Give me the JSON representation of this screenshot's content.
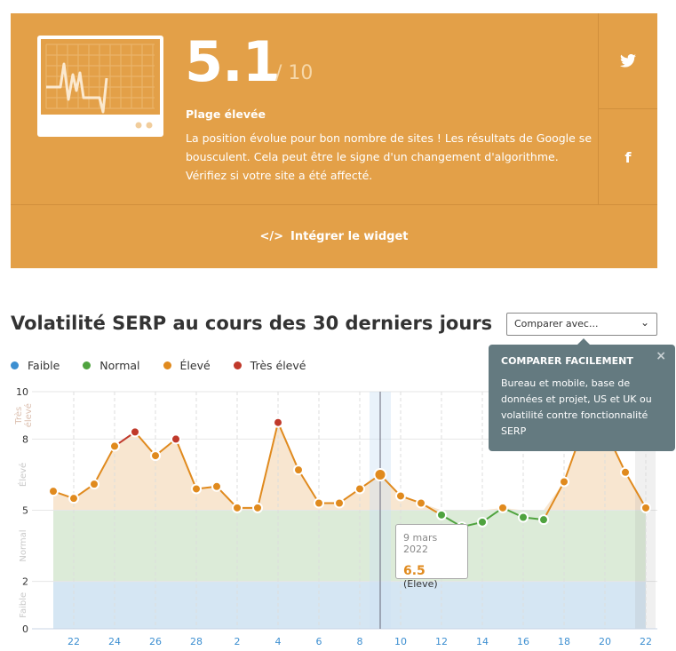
{
  "widget": {
    "score": "5.1",
    "out_of": "/ 10",
    "range_label": "Plage élevée",
    "description": "La position évolue pour bon nombre de sites ! Les résultats de Google se bousculent. Cela peut être le signe d'un changement d'algorithme. Vérifiez si votre site a été affecté.",
    "embed_label": "Intégrer le widget",
    "share": [
      "twitter-icon",
      "facebook-icon"
    ],
    "color": "#E3A048"
  },
  "section": {
    "title": "Volatilité SERP au cours des 30 derniers jours",
    "compare_select": "Comparer avec..."
  },
  "legend": [
    {
      "label": "Faible",
      "color": "#3d8fd1"
    },
    {
      "label": "Normal",
      "color": "#4fa33f"
    },
    {
      "label": "Élevé",
      "color": "#E08A1E"
    },
    {
      "label": "Très élevé",
      "color": "#c0392b"
    }
  ],
  "tooltip": {
    "date": "9 mars 2022",
    "value": "6.5",
    "category": "(Eleve)"
  },
  "popover": {
    "title": "COMPARER FACILEMENT",
    "body": "Bureau et mobile, base de données et projet, US et UK ou volatilité contre fonctionnalité SERP",
    "close": "×"
  },
  "chart_data": {
    "type": "line",
    "x": [
      "21",
      "22",
      "23",
      "24",
      "25",
      "26",
      "27",
      "28",
      "1",
      "2",
      "3",
      "4",
      "5",
      "6",
      "7",
      "8",
      "9",
      "10",
      "11",
      "12",
      "13",
      "14",
      "15",
      "16",
      "17",
      "18",
      "19",
      "20",
      "21",
      "22"
    ],
    "values": [
      5.8,
      5.5,
      6.1,
      7.7,
      8.3,
      7.3,
      8.0,
      5.9,
      6.0,
      5.1,
      5.1,
      8.7,
      6.7,
      5.3,
      5.3,
      5.9,
      6.5,
      5.6,
      5.3,
      4.8,
      4.3,
      4.5,
      5.1,
      4.7,
      4.6,
      6.2,
      8.6,
      8.4,
      6.6,
      5.1
    ],
    "xticks": [
      "22",
      "24",
      "26",
      "28",
      "2",
      "4",
      "6",
      "8",
      "10",
      "12",
      "14",
      "16",
      "18",
      "20",
      "22"
    ],
    "yticks": [
      0,
      2,
      5,
      8,
      10
    ],
    "ylim": [
      0,
      10
    ],
    "bands": [
      {
        "label": "Faible",
        "from": 0,
        "to": 2,
        "color": "#d5e6f3"
      },
      {
        "label": "Normal",
        "from": 2,
        "to": 5,
        "color": "#dcebd8"
      },
      {
        "label": "Élevé",
        "from": 5,
        "to": 8,
        "color": "#f8e6d0"
      },
      {
        "label": "Très élevé",
        "from": 8,
        "to": 10,
        "color": "#f8e6d0"
      }
    ],
    "highlight": "9"
  }
}
